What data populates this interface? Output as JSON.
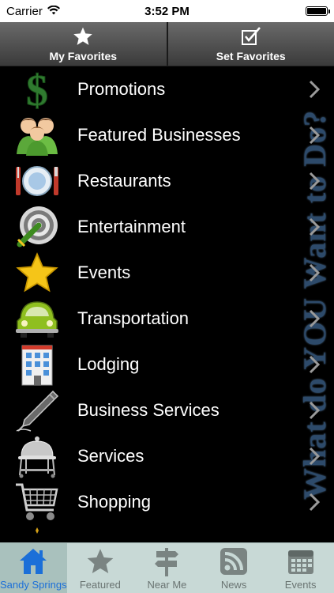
{
  "status_bar": {
    "carrier": "Carrier",
    "time": "3:52 PM"
  },
  "top_segments": [
    {
      "label": "My Favorites",
      "icon": "star-icon"
    },
    {
      "label": "Set Favorites",
      "icon": "checkbox-icon"
    }
  ],
  "side_banner": "What do YOU Want to Do?",
  "menu_items": [
    {
      "label": "Promotions",
      "icon": "dollar-sign-icon"
    },
    {
      "label": "Featured Businesses",
      "icon": "people-icon"
    },
    {
      "label": "Restaurants",
      "icon": "plate-utensils-icon"
    },
    {
      "label": "Entertainment",
      "icon": "target-icon"
    },
    {
      "label": "Events",
      "icon": "star-icon"
    },
    {
      "label": "Transportation",
      "icon": "car-icon"
    },
    {
      "label": "Lodging",
      "icon": "building-icon"
    },
    {
      "label": "Business Services",
      "icon": "pen-icon"
    },
    {
      "label": "Services",
      "icon": "cloche-icon"
    },
    {
      "label": "Shopping",
      "icon": "cart-icon"
    }
  ],
  "tabs": [
    {
      "label": "Sandy Springs",
      "icon": "home-icon",
      "active": true
    },
    {
      "label": "Featured",
      "icon": "star-icon",
      "active": false
    },
    {
      "label": "Near Me",
      "icon": "signpost-icon",
      "active": false
    },
    {
      "label": "News",
      "icon": "rss-icon",
      "active": false
    },
    {
      "label": "Events",
      "icon": "calendar-icon",
      "active": false
    }
  ],
  "colors": {
    "accent": "#1b6fd8",
    "tab_bar": "#c8d9d6",
    "banner": "#2d4a6a"
  }
}
